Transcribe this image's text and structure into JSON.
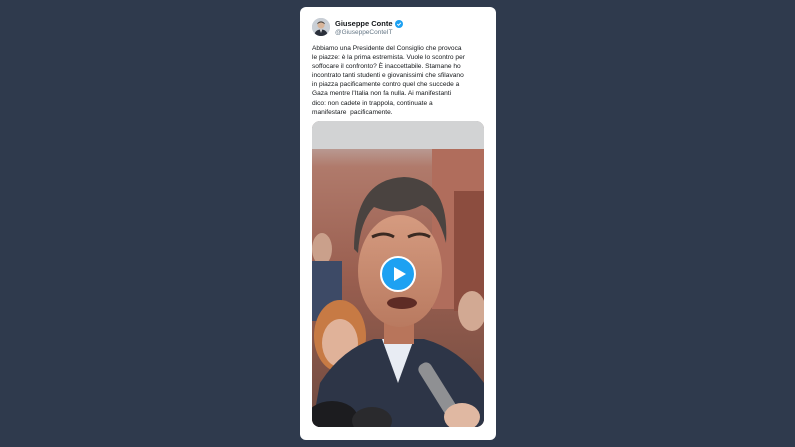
{
  "tweet": {
    "author_name": "Giuseppe Conte",
    "author_handle": "@GiuseppeConteIT",
    "verified": true,
    "text": "Abbiamo una Presidente del Consiglio che provoca\nle piazze: è la prima estremista. Vuole lo scontro per\nsoffocare il confronto? È inaccettabile. Stamane ho\nincontrato tanti studenti e giovanissimi che sfilavano\nin piazza pacificamente contro quel che succede a\nGaza mentre l'Italia non fa nulla. Ai manifestanti\ndico: non cadete in trappola, continuate a\nmanifestare  pacificamente."
  },
  "media": {
    "type": "video",
    "play_icon": "play-icon"
  },
  "colors": {
    "background": "#2f3a4d",
    "card": "#ffffff",
    "accent": "#1da1f2",
    "text": "#14171a",
    "secondary_text": "#657786"
  }
}
